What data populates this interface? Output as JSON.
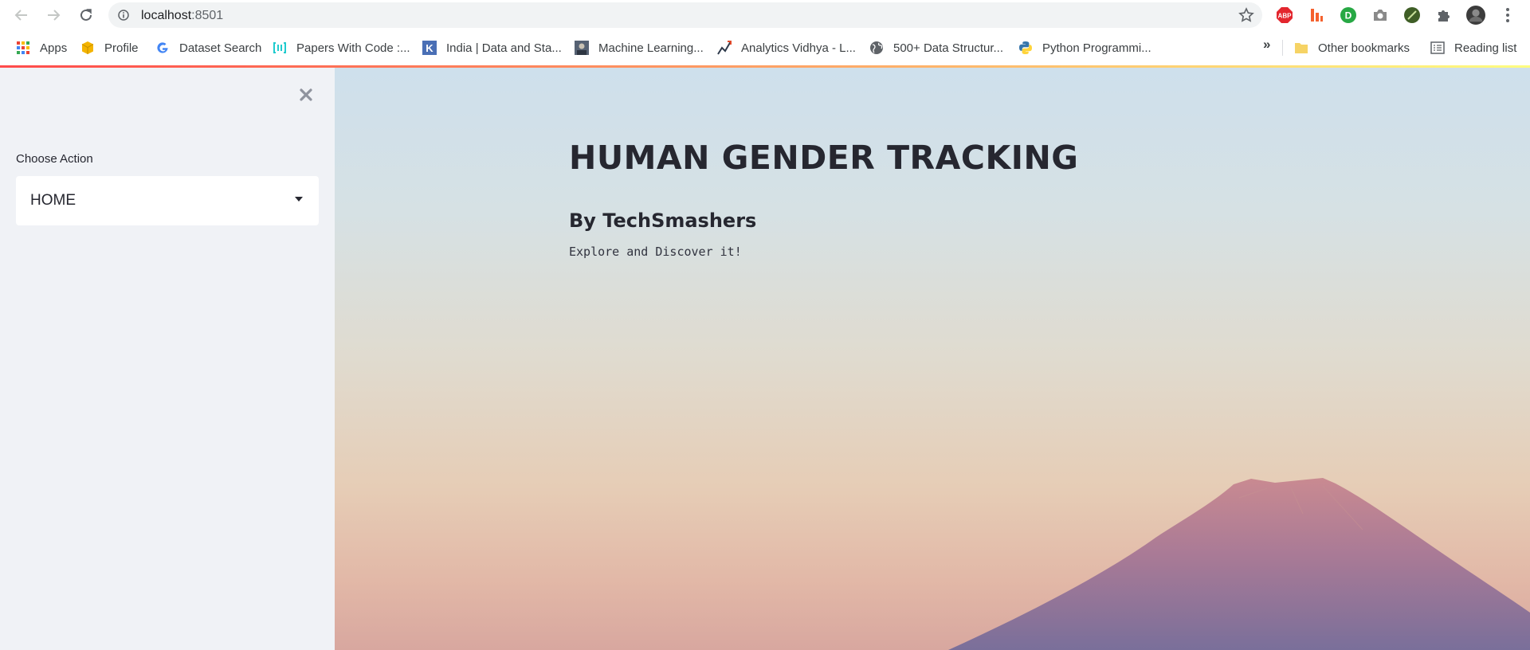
{
  "browser": {
    "url_host": "localhost",
    "url_port": ":8501",
    "icons": {
      "back": "arrow-left-icon",
      "forward": "arrow-right-icon",
      "reload": "reload-icon",
      "site_info": "info-icon",
      "bookmark": "star-icon",
      "menu": "kebab-menu-icon"
    },
    "extensions": [
      {
        "name": "adblock-plus-icon",
        "label": "ABP",
        "color": "#e3262e"
      },
      {
        "name": "bars-extension-icon",
        "color": "#f5622e"
      },
      {
        "name": "green-d-extension-icon",
        "label": "D",
        "color": "#27a844"
      },
      {
        "name": "camera-extension-icon",
        "color": "#8a8a8a"
      },
      {
        "name": "leaf-extension-icon",
        "color": "#4a6b2d"
      },
      {
        "name": "puzzle-extensions-icon",
        "color": "#5f6368"
      },
      {
        "name": "profile-avatar-icon",
        "color": "#3c3c3c"
      }
    ]
  },
  "bookmarks": {
    "items": [
      {
        "label": "Apps",
        "icon": "apps-grid-icon"
      },
      {
        "label": "Profile",
        "icon": "box-icon"
      },
      {
        "label": "Dataset Search",
        "icon": "google-icon"
      },
      {
        "label": "Papers With Code :...",
        "icon": "papers-with-code-icon"
      },
      {
        "label": "India | Data and Sta...",
        "icon": "kaggle-k-icon"
      },
      {
        "label": "Machine Learning...",
        "icon": "ml-thumbnail-icon"
      },
      {
        "label": "Analytics Vidhya - L...",
        "icon": "analytics-chart-icon"
      },
      {
        "label": "500+ Data Structur...",
        "icon": "globe-icon"
      },
      {
        "label": "Python Programmi...",
        "icon": "python-icon"
      }
    ],
    "overflow": "»",
    "other_bookmarks": "Other bookmarks",
    "reading_list": "Reading list"
  },
  "sidebar": {
    "select_label": "Choose Action",
    "select_value": "HOME",
    "close_icon": "close-icon"
  },
  "main": {
    "title": "HUMAN GENDER TRACKING",
    "subtitle": "By TechSmashers",
    "tagline": "Explore and Discover it!"
  },
  "colors": {
    "accent_gradient_start": "#ff4b4b",
    "accent_gradient_end": "#fffd80",
    "sidebar_bg": "#f0f2f6",
    "text": "#262730"
  }
}
